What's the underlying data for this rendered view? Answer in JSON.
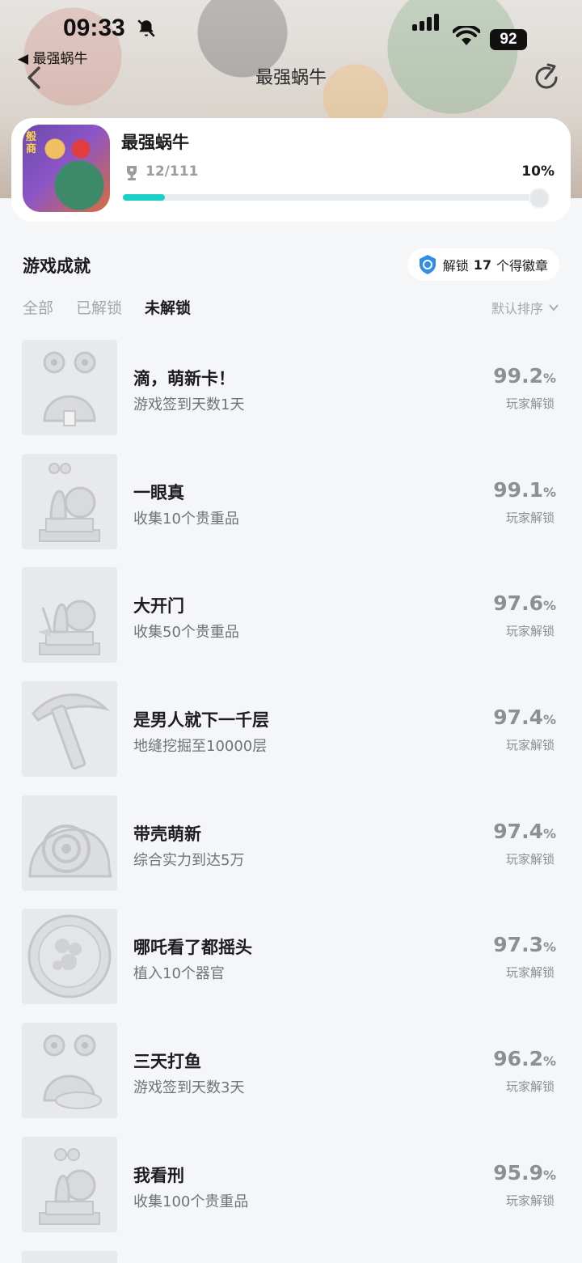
{
  "status_bar": {
    "time": "09:33",
    "battery": "92",
    "back_app_label": "◀ 最强蜗牛"
  },
  "nav": {
    "title": "最强蜗牛",
    "icons": [
      "chevron-left-icon",
      "share-icon"
    ]
  },
  "game": {
    "name": "最强蜗牛",
    "icon_tag": "般商",
    "trophy_count": "12/111",
    "percent_label": "10%",
    "progress": 0.1,
    "accent_color": "#1dd0c6"
  },
  "section": {
    "title": "游戏成就",
    "badge_prefix": "解锁",
    "badge_count": "17",
    "badge_suffix": "个得徽章"
  },
  "tabs": [
    {
      "label": "全部",
      "active": false
    },
    {
      "label": "已解锁",
      "active": false
    },
    {
      "label": "未解锁",
      "active": true
    }
  ],
  "sort_label": "默认排序",
  "achievements": [
    {
      "title": "滴，萌新卡！",
      "desc": "游戏签到天数1天",
      "rate": "99.2",
      "unit": "%",
      "rate_label": "玩家解锁",
      "icon": "snail-card-icon"
    },
    {
      "title": "一眼真",
      "desc": "收集10个贵重品",
      "rate": "99.1",
      "unit": "%",
      "rate_label": "玩家解锁",
      "icon": "snail-statue-icon"
    },
    {
      "title": "大开门",
      "desc": "收集50个贵重品",
      "rate": "97.6",
      "unit": "%",
      "rate_label": "玩家解锁",
      "icon": "snail-statue-shovel-icon"
    },
    {
      "title": "是男人就下一千层",
      "desc": "地缝挖掘至10000层",
      "rate": "97.4",
      "unit": "%",
      "rate_label": "玩家解锁",
      "icon": "pickaxe-icon"
    },
    {
      "title": "带壳萌新",
      "desc": "综合实力到达5万",
      "rate": "97.4",
      "unit": "%",
      "rate_label": "玩家解锁",
      "icon": "snail-shell-icon"
    },
    {
      "title": "哪吒看了都摇头",
      "desc": "植入10个器官",
      "rate": "97.3",
      "unit": "%",
      "rate_label": "玩家解锁",
      "icon": "organ-plate-icon"
    },
    {
      "title": "三天打鱼",
      "desc": "游戏签到天数3天",
      "rate": "96.2",
      "unit": "%",
      "rate_label": "玩家解锁",
      "icon": "snail-fish-icon"
    },
    {
      "title": "我看刑",
      "desc": "收集100个贵重品",
      "rate": "95.9",
      "unit": "%",
      "rate_label": "玩家解锁",
      "icon": "snail-angry-statue-icon"
    }
  ]
}
